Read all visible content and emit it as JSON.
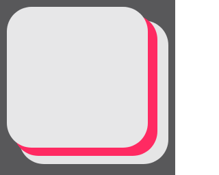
{
  "colors": {
    "background": "#58585a",
    "card_front": "#e7e7e8",
    "card_accent": "#ff2a62",
    "card_back": "#e5e5e6"
  },
  "layers": [
    {
      "role": "back",
      "color": "#e5e5e6"
    },
    {
      "role": "accent",
      "color": "#ff2a62"
    },
    {
      "role": "front",
      "color": "#e7e7e8"
    }
  ]
}
